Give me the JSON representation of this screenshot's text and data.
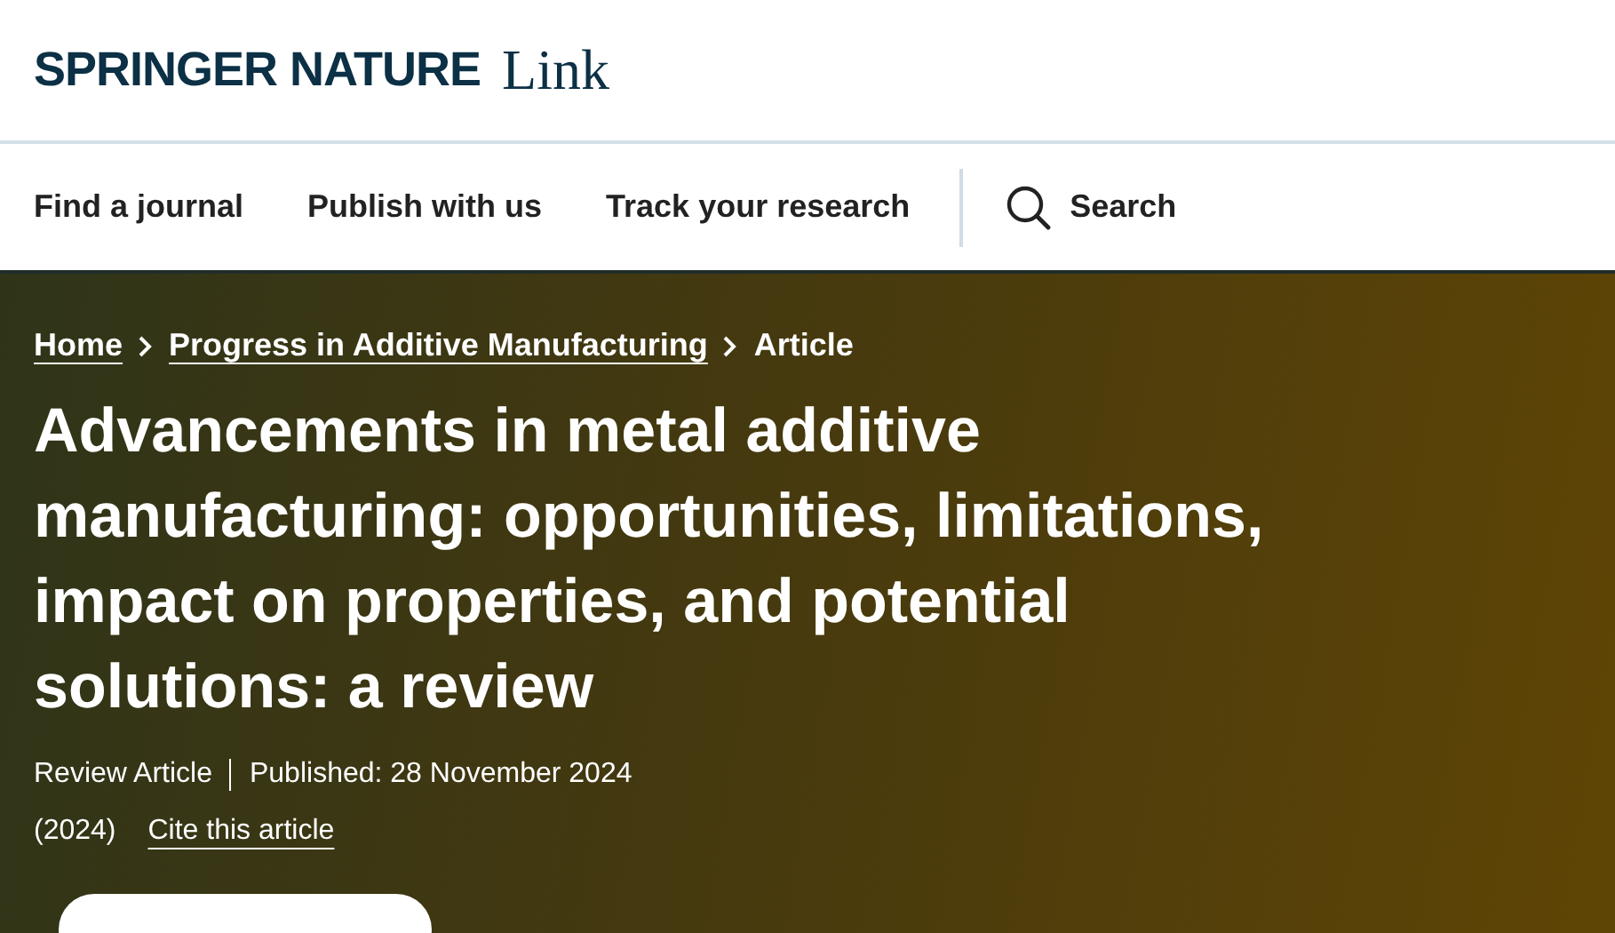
{
  "header": {
    "logo_brand": "SPRINGER NATURE",
    "logo_product": "Link"
  },
  "nav": {
    "items": [
      "Find a journal",
      "Publish with us",
      "Track your research"
    ],
    "search": "Search"
  },
  "breadcrumb": [
    {
      "label": "Home",
      "link": true
    },
    {
      "label": "Progress in Additive Manufacturing",
      "link": true
    },
    {
      "label": "Article",
      "link": false
    }
  ],
  "article": {
    "title": "Advancements in metal additive manufacturing: opportunities, limitations, impact on properties, and potential solutions: a review",
    "type": "Review Article",
    "published": "Published: 28 November 2024",
    "year": "(2024)",
    "cite": "Cite this article"
  }
}
